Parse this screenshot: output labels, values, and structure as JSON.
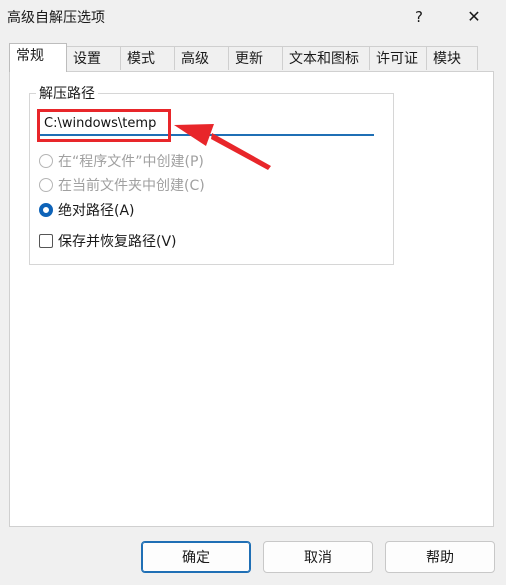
{
  "window": {
    "title": "高级自解压选项",
    "help_label": "?",
    "close_label": "✕"
  },
  "tabs": [
    "常规",
    "设置",
    "模式",
    "高级",
    "更新",
    "文本和图标",
    "许可证",
    "模块"
  ],
  "active_tab": "常规",
  "group": {
    "title": "解压路径",
    "path_value": "C:\\windows\\temp"
  },
  "options": {
    "radio_program_files": "在“程序文件”中创建(P)",
    "radio_current_folder": "在当前文件夹中创建(C)",
    "radio_absolute": "绝对路径(A)",
    "checkbox_save_restore": "保存并恢复路径(V)"
  },
  "buttons": {
    "ok": "确定",
    "cancel": "取消",
    "help": "帮助"
  },
  "colors": {
    "annotation_red": "#e8262a",
    "accent_blue": "#1f6fb5"
  }
}
